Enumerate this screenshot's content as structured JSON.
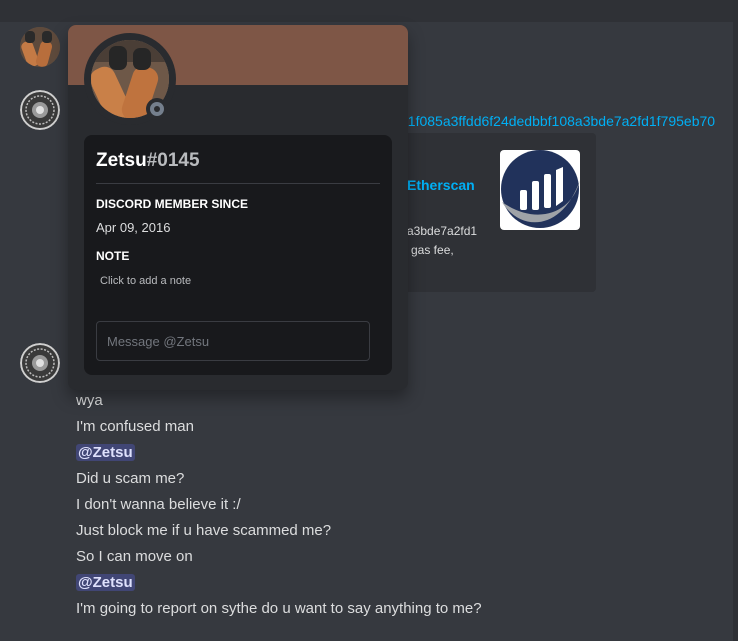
{
  "channel": {
    "link_text": "21f085a3ffdd6f24dedbbf108a3bde7a2fd1f795eb70",
    "embed": {
      "title": "Etherscan",
      "description_line1": "a3bde7a2fd1",
      "description_line2": "gas fee,",
      "thumbnail_icon": "etherscan-logo-icon"
    },
    "messages": [
      {
        "text": "wya"
      },
      {
        "text": "I'm confused man"
      },
      {
        "mention": "@Zetsu"
      },
      {
        "text": "Did u scam me?"
      },
      {
        "text": "I don't wanna believe it :/"
      },
      {
        "text": "Just block me if u have scammed me?"
      },
      {
        "text": "So I can move on"
      },
      {
        "mention": "@Zetsu"
      },
      {
        "text": "I'm going to report on sythe do u want to say anything to me?"
      }
    ]
  },
  "popout": {
    "username": "Zetsu",
    "discriminator": "#0145",
    "member_since_label": "DISCORD MEMBER SINCE",
    "member_since_value": "Apr 09, 2016",
    "note_label": "NOTE",
    "note_placeholder": "Click to add a note",
    "message_placeholder": "Message @Zetsu",
    "banner_color": "#7e5646",
    "status": "offline"
  },
  "colors": {
    "background": "#36393f",
    "link": "#00aff4",
    "mention_bg": "#414675"
  }
}
